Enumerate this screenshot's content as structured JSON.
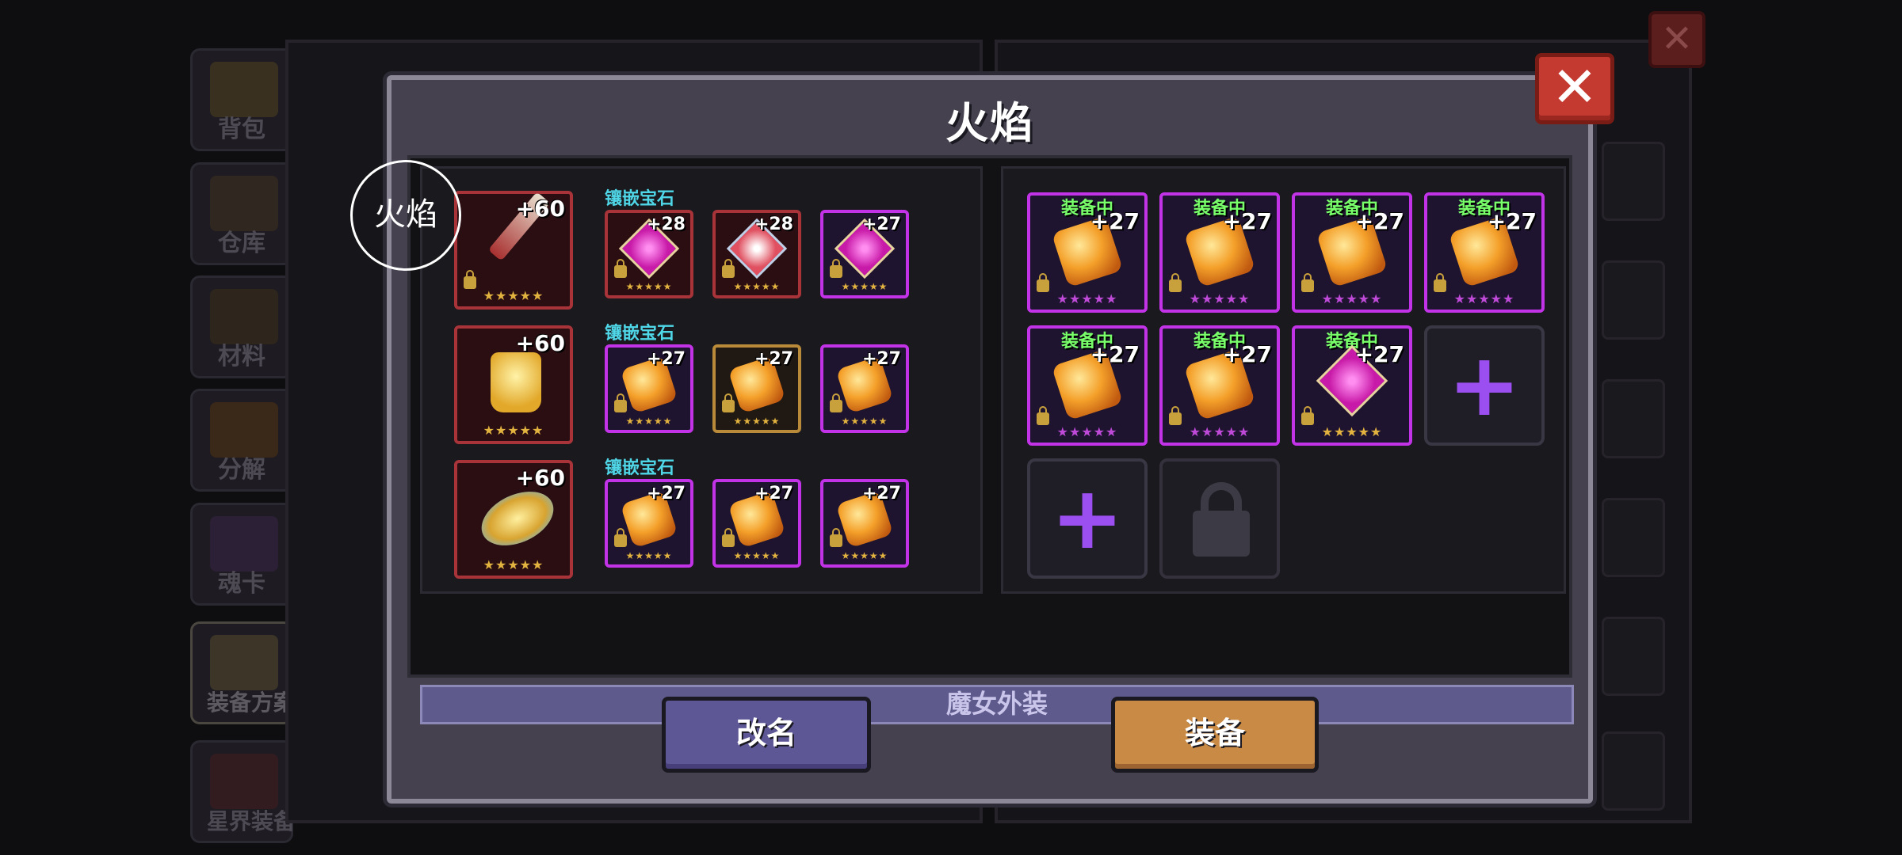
{
  "modal": {
    "title": "火焰",
    "close_label": "✕",
    "gem_label_1": "镶嵌宝石",
    "gem_label_2": "镶嵌宝石",
    "gem_label_3": "镶嵌宝石",
    "outfit_label": "魔女外装",
    "rename_button": "改名",
    "equip_button": "装备",
    "tooltip_text": "火焰"
  },
  "left_panel": {
    "rows": [
      {
        "main_level": "+60",
        "gems": [
          "+28",
          "+28",
          "+27"
        ]
      },
      {
        "main_level": "+60",
        "gems": [
          "+27",
          "+27",
          "+27"
        ]
      },
      {
        "main_level": "+60",
        "gems": [
          "+27",
          "+27",
          "+27"
        ]
      }
    ]
  },
  "right_panel": {
    "equipped_tag": "装备中",
    "items": [
      {
        "level": "+27",
        "tag": "装备中"
      },
      {
        "level": "+27",
        "tag": "装备中"
      },
      {
        "level": "+27",
        "tag": "装备中"
      },
      {
        "level": "+27",
        "tag": "装备中"
      },
      {
        "level": "+27",
        "tag": "装备中"
      },
      {
        "level": "+27",
        "tag": "装备中"
      },
      {
        "level": "+27",
        "tag": "装备中"
      }
    ],
    "add_symbol": "+"
  },
  "background_sidebar": {
    "items": [
      "背包",
      "仓库",
      "材料",
      "分解",
      "魂卡",
      "装备方案",
      "星界装备"
    ]
  },
  "background": {
    "close_label": "✕"
  },
  "stars": "★★★★★"
}
